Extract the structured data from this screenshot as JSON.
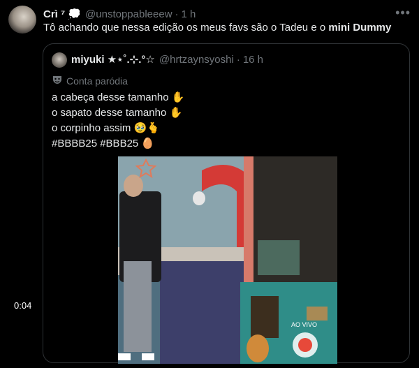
{
  "author": {
    "name": "Crì ⁷ 💭",
    "handle": "@unstoppableeew",
    "separator": "·",
    "time": "1 h"
  },
  "tweet": {
    "text_before": "Tô achando que nessa edição os meus favs são o Tadeu e o ",
    "text_bold": "mini Dummy"
  },
  "more_label": "•••",
  "quote": {
    "author_name": "miyuki ★⋆˚.⊹.°☆",
    "handle": "@hrtzaynsyoshi",
    "separator": "·",
    "time": "16 h",
    "parody_label": "Conta paródia",
    "lines": [
      "a cabeça desse tamanho ✋",
      "o sapato desse tamanho ✋",
      "o corpinho assim 🥹🫰",
      "#BBBB25 #BBB25 🥚"
    ],
    "video_time": "0:04",
    "video_overlay": "AO VIVO"
  },
  "icons": {
    "parody": "mask-icon",
    "more": "more-icon"
  }
}
